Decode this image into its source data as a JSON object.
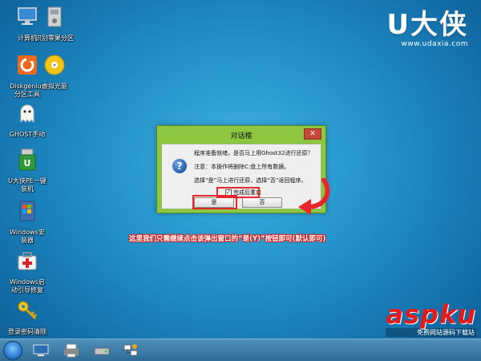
{
  "desktop": {
    "icons": [
      {
        "label": "计算机",
        "icon": "computer-icon"
      },
      {
        "label": "识别零果分区",
        "icon": "drive-icon"
      },
      {
        "label": "Diskgenius\n分区工具",
        "icon": "diskgenius-icon"
      },
      {
        "label": "虚拟光驱",
        "icon": "virtual-cd-icon"
      },
      {
        "label": "GHOST手动",
        "icon": "ghost-icon"
      },
      {
        "label": "U大侠PE一键\n装机",
        "icon": "udaxia-installer-icon"
      },
      {
        "label": "Windows安\n装器",
        "icon": "windows-installer-icon"
      },
      {
        "label": "Windows启\n动引导修复",
        "icon": "boot-repair-icon"
      },
      {
        "label": "登录密码清除",
        "icon": "password-key-icon"
      }
    ]
  },
  "brand": {
    "logo": "U大侠",
    "url": "www.udaxia.com"
  },
  "dialog": {
    "title": "对话框",
    "close": "✕",
    "message1": "程序准备就绪，是否马上用Ghost32进行还原？",
    "message2": "注意：本操作将删除C:盘上所有数据。",
    "message3": "选择“是”马上进行还原，选择“否”返回程序。",
    "checkbox_label": "完成后重启",
    "checkbox_checked": true,
    "yes_label": "是",
    "no_label": "否"
  },
  "annotation": {
    "caption": "这里我们只需继续点击该弹出窗口的“是(Y)”按钮即可(默认即可)",
    "color": "#e8272c"
  },
  "watermark": {
    "main": "aspku",
    "sub": "免费网站源码下载站"
  },
  "taskbar": {
    "icons": [
      "start-orb-icon",
      "monitor-icon",
      "printer-icon",
      "drive-icon",
      "network-icon"
    ]
  }
}
